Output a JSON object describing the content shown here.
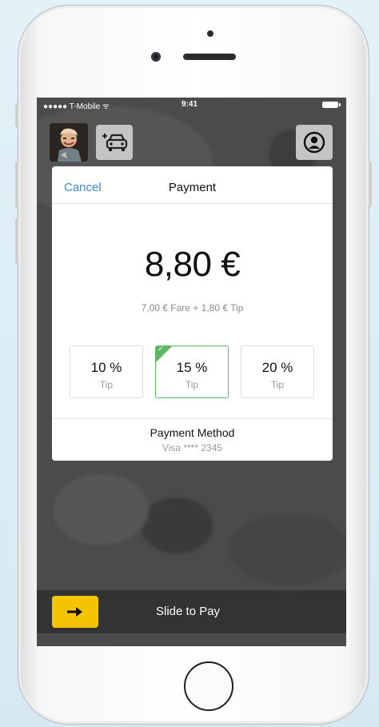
{
  "status_bar": {
    "carrier": "●●●●● T-Mobile ᯤ",
    "time": "9:41"
  },
  "payment": {
    "cancel_label": "Cancel",
    "title": "Payment",
    "amount": "8,80 €",
    "breakdown": "7,00 € Fare + 1,80 € Tip",
    "tips": [
      {
        "percent": "10 %",
        "label": "Tip",
        "selected": false
      },
      {
        "percent": "15 %",
        "label": "Tip",
        "selected": true
      },
      {
        "percent": "20 %",
        "label": "Tip",
        "selected": false
      }
    ],
    "method_title": "Payment Method",
    "method_value": "Visa **** 2345"
  },
  "slider": {
    "label": "Slide to Pay"
  },
  "icons": {
    "avatar": "user-photo",
    "add_taxi": "add-taxi-icon",
    "profile": "profile-icon",
    "slider_arrow": "arrow-right-icon",
    "check": "checkmark-icon"
  },
  "colors": {
    "accent_link": "#3a8bd2",
    "selected_tip_border": "#5bb863",
    "slider_handle": "#f5c400",
    "bottom_bar": "#333333"
  }
}
